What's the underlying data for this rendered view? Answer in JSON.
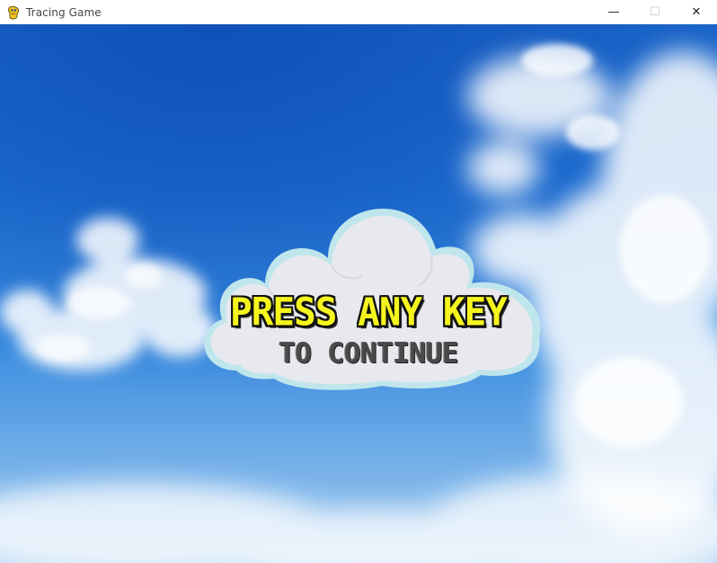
{
  "window": {
    "title": "Tracing Game",
    "icon": "pygame-snake-icon",
    "controls": {
      "minimize": "—",
      "maximize": "☐",
      "close": "✕"
    }
  },
  "game": {
    "background": "blue-sky-with-clouds",
    "message_line1": "PRESS ANY KEY",
    "message_line2": "TO CONTINUE",
    "colors": {
      "line1": "#f5f51e",
      "line2": "#4a4a4a",
      "cloud_fill": "#e8e9ee",
      "cloud_outline": "#bfe6ec"
    }
  }
}
